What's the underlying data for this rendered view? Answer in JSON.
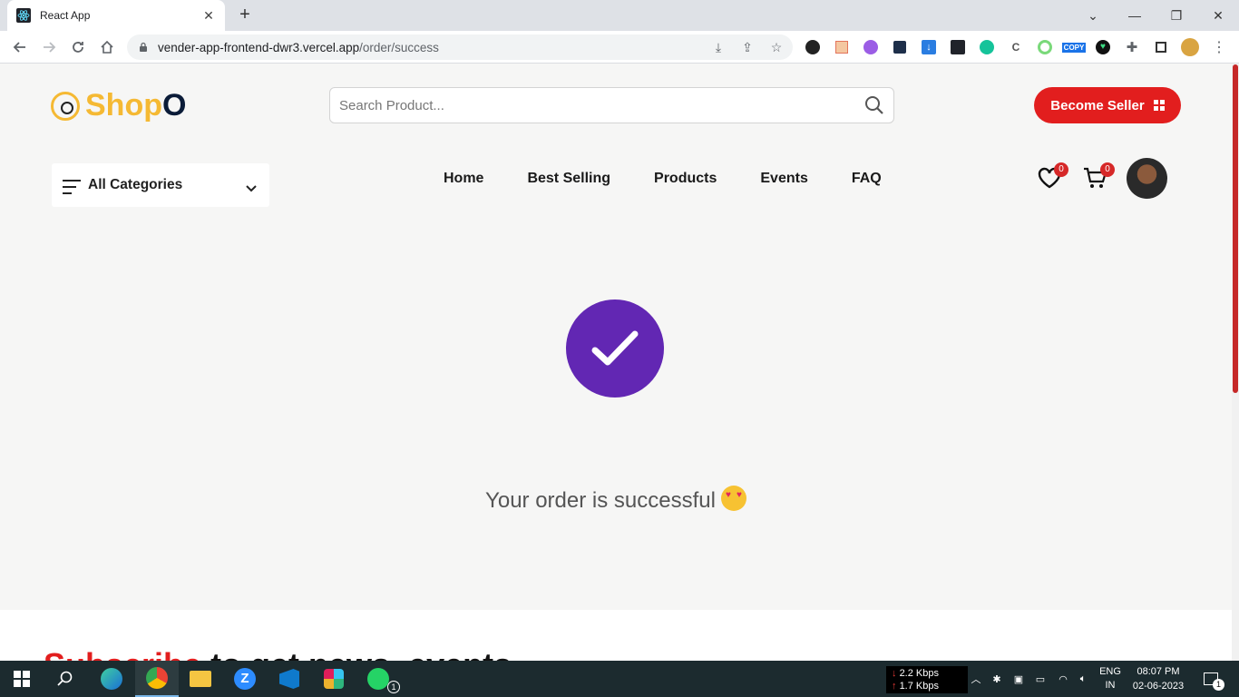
{
  "browser": {
    "tab_title": "React App",
    "url_host": "vender-app-frontend-dwr3.vercel.app",
    "url_path": "/order/success",
    "extension_copy_label": "COPY"
  },
  "header": {
    "logo_main": "Shop",
    "logo_o": "O",
    "search_placeholder": "Search Product...",
    "become_seller_label": "Become Seller"
  },
  "nav": {
    "categories_label": "All Categories",
    "links": [
      "Home",
      "Best Selling",
      "Products",
      "Events",
      "FAQ"
    ],
    "wishlist_count": "0",
    "cart_count": "0"
  },
  "main": {
    "success_message": "Your order is successful"
  },
  "footer": {
    "subscribe_red": "Subscribe",
    "subscribe_rest": " to get news, events"
  },
  "taskbar": {
    "net_down": "2.2 Kbps",
    "net_up": "1.7 Kbps",
    "lang_line1": "ENG",
    "lang_line2": "IN",
    "time": "08:07 PM",
    "date": "02-06-2023",
    "notification_count": "1",
    "whatsapp_count": "1"
  },
  "colors": {
    "accent_red": "#e21e1e",
    "success_purple": "#6227b3",
    "logo_yellow": "#f5b933"
  }
}
